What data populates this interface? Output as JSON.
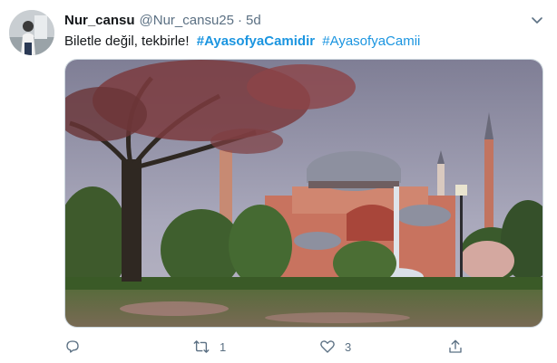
{
  "tweet": {
    "display_name": "Nur_cansu",
    "handle": "@Nur_cansu25",
    "separator": "·",
    "time": "5d",
    "text_plain": "Biletle değil, tekbirle!",
    "hashtag_bold": "#AyasofyaCamidir",
    "hashtag": "#AyasofyaCamii"
  },
  "actions": {
    "reply": {
      "icon": "reply-icon",
      "count": ""
    },
    "retweet": {
      "icon": "retweet-icon",
      "count": "1"
    },
    "like": {
      "icon": "heart-icon",
      "count": "3"
    },
    "share": {
      "icon": "share-icon",
      "count": ""
    }
  },
  "colors": {
    "hashtag": "#1b95e0",
    "secondary_text": "#5b7083",
    "primary_text": "#14171a"
  }
}
